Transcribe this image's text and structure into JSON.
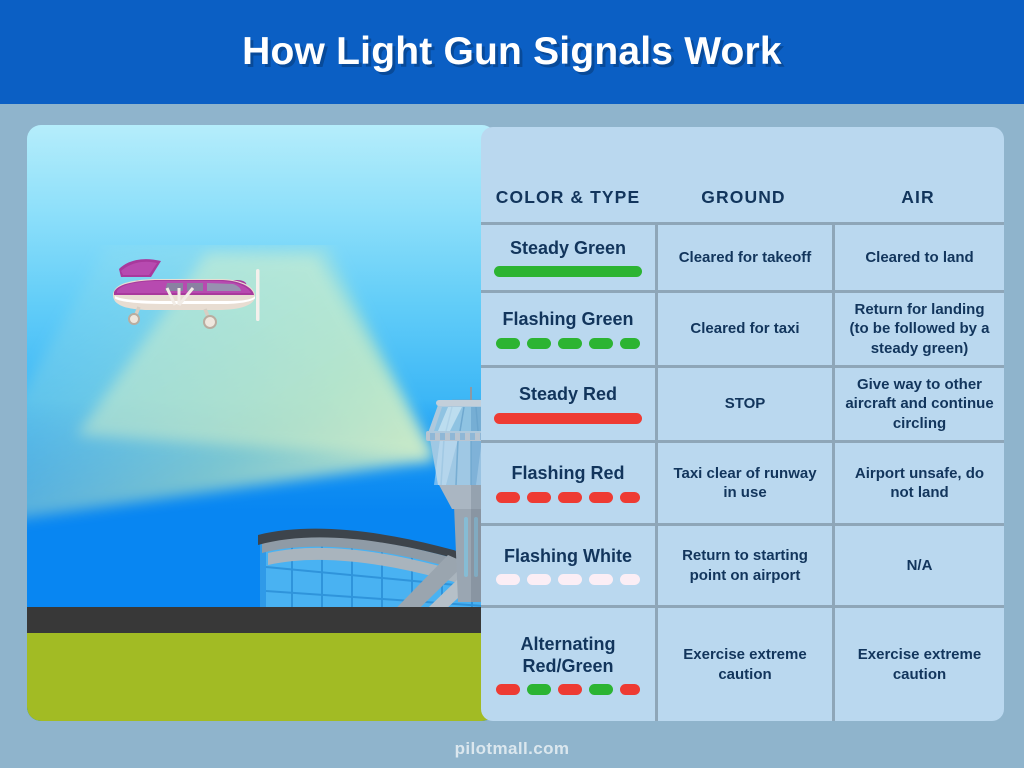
{
  "header": {
    "title": "How Light Gun Signals Work",
    "banner_color": "#0b5fc4"
  },
  "illustration": {
    "name": "airport-light-gun-scene",
    "sky_top_color": "#b5edfb",
    "sky_bottom_color": "#0886f2",
    "grass_color": "#a2bb24",
    "runway_color": "#383838",
    "beam_color": "#d8f0b8",
    "airplane_color": "#a8399d",
    "airplane_body_color": "#e8ddd2",
    "tower_color": "#b9c7d4",
    "terminal_glass_color": "#3fa9f0"
  },
  "table": {
    "background_color": "#bad8ef",
    "text_color": "#12355c",
    "divider_color": "#8ea6b8",
    "columns": [
      {
        "key": "color_type",
        "label": "COLOR & TYPE"
      },
      {
        "key": "ground",
        "label": "GROUND"
      },
      {
        "key": "air",
        "label": "AIR"
      }
    ],
    "rows": [
      {
        "signal": "Steady Green",
        "ground": "Cleared for takeoff",
        "air": "Cleared to land",
        "indicator": "solid",
        "colors": [
          "#2cb432"
        ]
      },
      {
        "signal": "Flashing Green",
        "ground": "Cleared for taxi",
        "air": "Return for landing (to be followed by a steady green)",
        "indicator": "dashed",
        "colors": [
          "#2cb432",
          "#2cb432",
          "#2cb432",
          "#2cb432",
          "#2cb432"
        ]
      },
      {
        "signal": "Steady Red",
        "ground": "STOP",
        "air": "Give way to other aircraft and continue circling",
        "indicator": "solid",
        "colors": [
          "#ee3b33"
        ]
      },
      {
        "signal": "Flashing Red",
        "ground": "Taxi clear of runway in use",
        "air": "Airport unsafe, do not land",
        "indicator": "dashed",
        "colors": [
          "#ee3b33",
          "#ee3b33",
          "#ee3b33",
          "#ee3b33",
          "#ee3b33"
        ]
      },
      {
        "signal": "Flashing White",
        "ground": "Return to starting point on airport",
        "air": "N/A",
        "indicator": "dashed",
        "colors": [
          "#fbeef5",
          "#fbeef5",
          "#fbeef5",
          "#fbeef5",
          "#fbeef5"
        ]
      },
      {
        "signal": "Alternating Red/Green",
        "ground": "Exercise extreme caution",
        "air": "Exercise extreme caution",
        "indicator": "dashed",
        "colors": [
          "#ee3b33",
          "#2cb432",
          "#ee3b33",
          "#2cb432",
          "#ee3b33"
        ]
      }
    ]
  },
  "footer": {
    "source": "pilotmall.com"
  }
}
